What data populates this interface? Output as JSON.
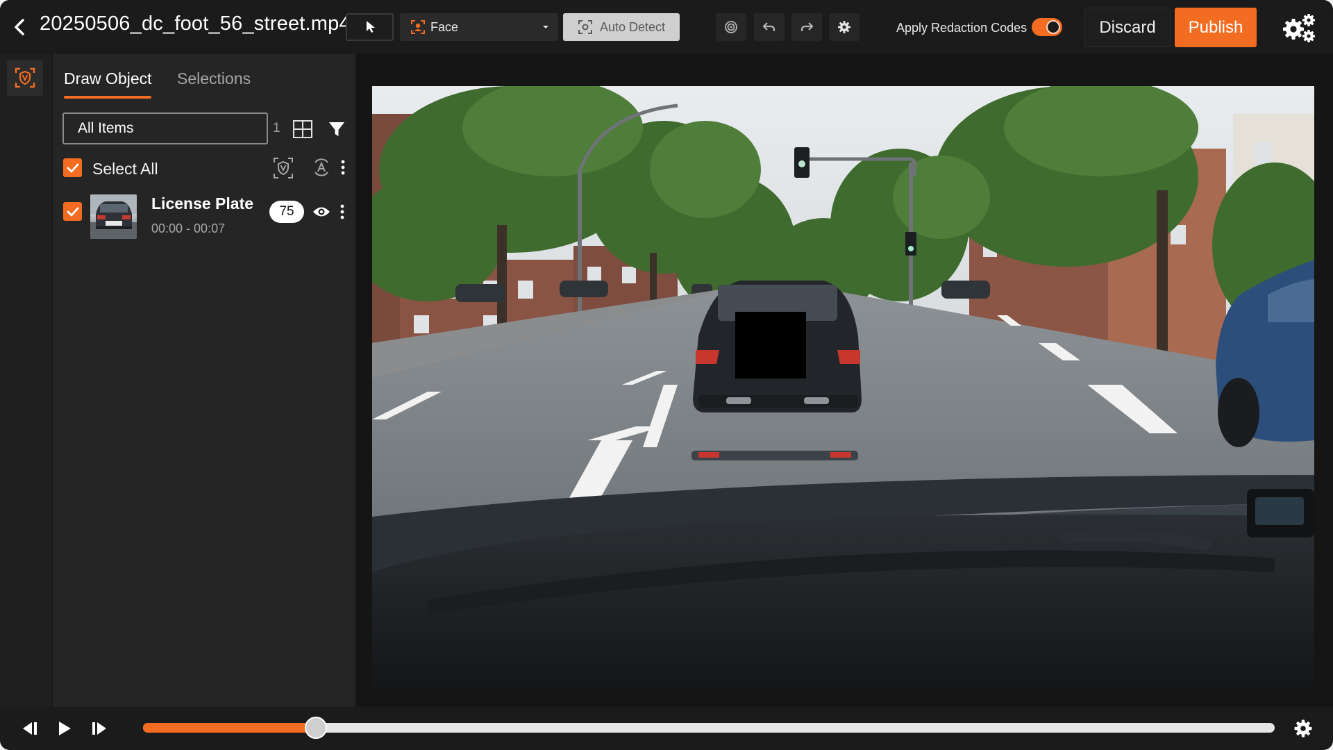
{
  "header": {
    "file_name": "20250506_dc_foot_56_street.mp4",
    "detect_type": "Face",
    "auto_detect_label": "Auto Detect",
    "apply_codes_label": "Apply Redaction Codes",
    "apply_codes_on": true,
    "discard_label": "Discard",
    "publish_label": "Publish"
  },
  "panel": {
    "tabs": [
      {
        "label": "Draw Object",
        "active": true
      },
      {
        "label": "Selections",
        "active": false
      }
    ],
    "search": {
      "placeholder": "All Items",
      "count": "1"
    },
    "select_all_label": "Select All",
    "items": [
      {
        "title": "License Plate",
        "time_range": "00:00 - 00:07",
        "badge": "75",
        "checked": true
      }
    ]
  },
  "playback": {
    "progress": 0.153
  },
  "icons": {
    "back": "chevron-left-icon",
    "pointer": "cursor-pointer-icon",
    "face": "face-detect-icon",
    "auto_detect": "scan-focus-icon",
    "target": "target-icon",
    "undo": "undo-icon",
    "redo": "redo-icon",
    "gear": "gear-icon",
    "settings": "gears-icon"
  },
  "colors": {
    "accent": "#f26d21",
    "background": "#1e1e1e",
    "panel": "#252525"
  }
}
